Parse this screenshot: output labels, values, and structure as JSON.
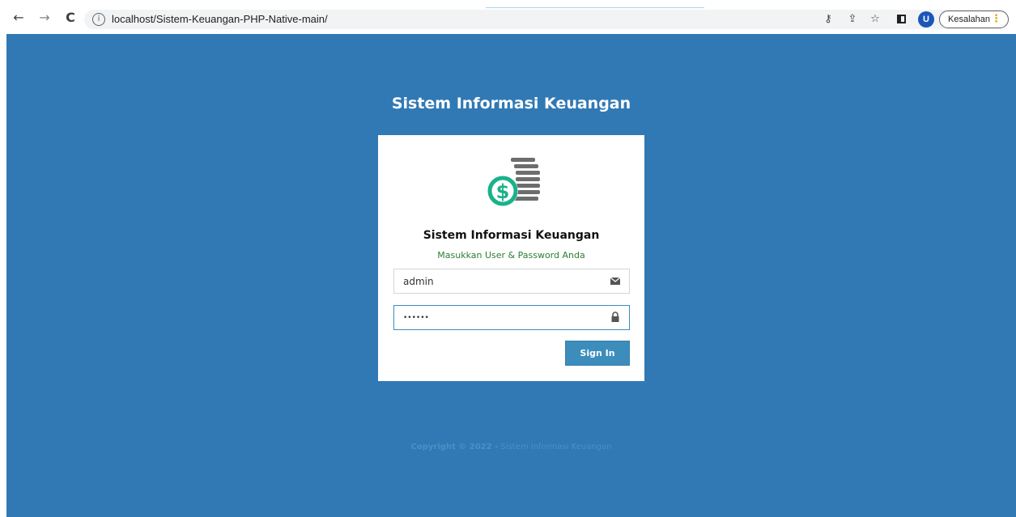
{
  "browser": {
    "back_icon": "arrow-left-icon",
    "forward_icon": "arrow-right-icon",
    "reload_icon": "reload-icon",
    "url": "localhost/Sistem-Keuangan-PHP-Native-main/",
    "avatar_letter": "U",
    "error_label": "Kesalahan"
  },
  "page": {
    "title": "Sistem Informasi Keuangan",
    "background_color": "#3179b4"
  },
  "login": {
    "logo_icon": "money-coins-icon",
    "title": "Sistem Informasi Keuangan",
    "subtitle": "Masukkan User & Password Anda",
    "username_value": "admin",
    "password_value": "••••••",
    "signin_label": "Sign In",
    "accent_color": "#3c8dbc",
    "subtitle_color": "#2e7d32"
  },
  "footer": {
    "copyright_prefix": "Copyright © 2022 -",
    "copyright_name": "Sistem Informasi Keuangan"
  }
}
